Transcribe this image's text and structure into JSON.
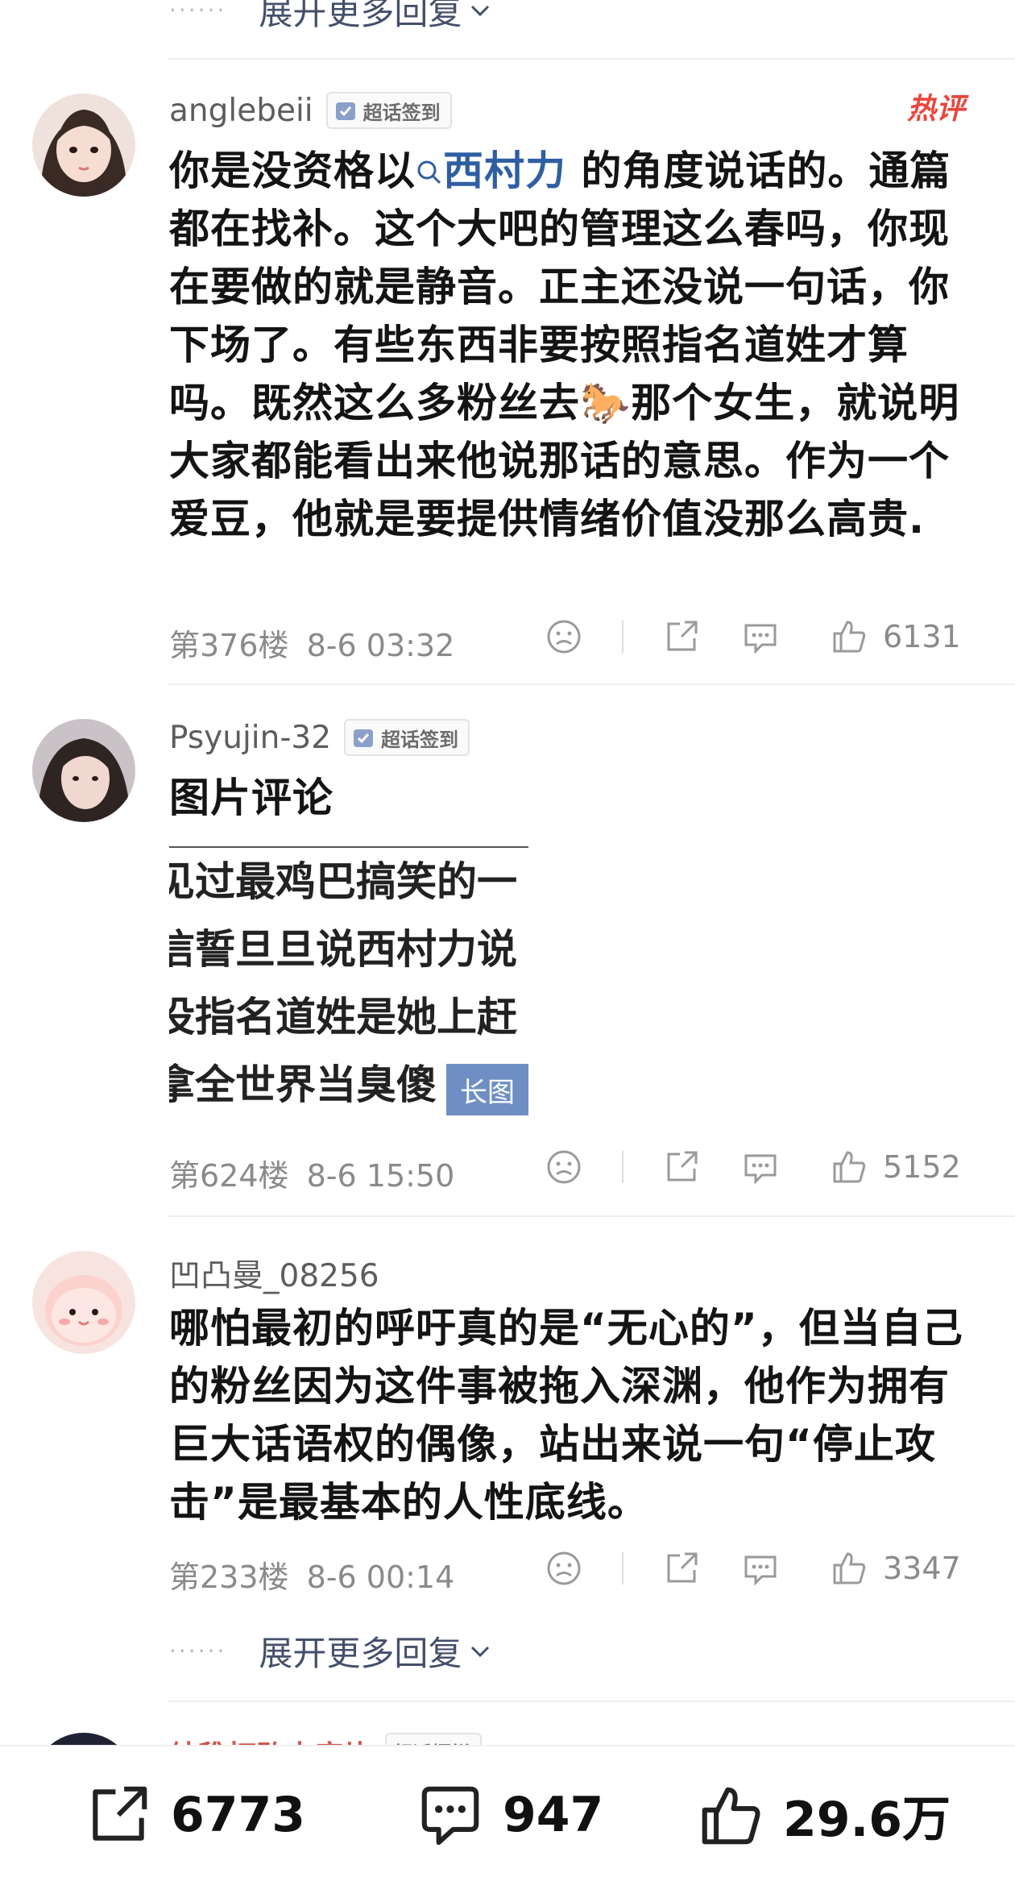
{
  "top_expand": {
    "label": "展开更多回复"
  },
  "comments": [
    {
      "username": "anglebeii",
      "badge": "超话签到",
      "hot_tag": "热评",
      "text_before": "你是没资格以",
      "topic": "西村力",
      "text_after": " 的角度说话的。通篇都在找补。这个大吧的管理这么春吗，你现在要做的就是静音。正主还没说一句话，你下场了。有些东西非要按照指名道姓才算吗。既然这么多粉丝去🐎那个女生，就说明大家都能看出来他说那话的意思。作为一个爱豆，他就是要提供情绪价值没那么高贵.",
      "floor": "第376楼",
      "time": "8-6 03:32",
      "likes": "6131"
    },
    {
      "username": "Psyujin-32",
      "badge": "超话签到",
      "text": "图片评论",
      "image_lines": [
        "见过最鸡巴搞笑的一",
        "信誓旦旦说西村力说",
        "没指名道姓是她上赶",
        "拿全世界当臭傻"
      ],
      "image_tag": "长图",
      "floor": "第624楼",
      "time": "8-6 15:50",
      "likes": "5152"
    },
    {
      "username": "凹凸曼_08256",
      "text": "哪怕最初的呼吁真的是“无心的”，但当自己的粉丝因为这件事被拖入深渊，他作为拥有巨大话语权的偶像，站出来说一句“停止攻击”是最基本的人性底线。",
      "floor": "第233楼",
      "time": "8-6 00:14",
      "likes": "3347"
    }
  ],
  "bottom_expand": {
    "label": "展开更多回复"
  },
  "partial_next": {
    "username": "纳稚打败未度片",
    "badge": "超话摆烂"
  },
  "bottom_bar": {
    "share_count": "6773",
    "comment_count": "947",
    "like_count": "29.6万"
  },
  "colors": {
    "accent": "#2f5fa3",
    "hot": "#e8473c",
    "muted": "#8a8a8a"
  }
}
